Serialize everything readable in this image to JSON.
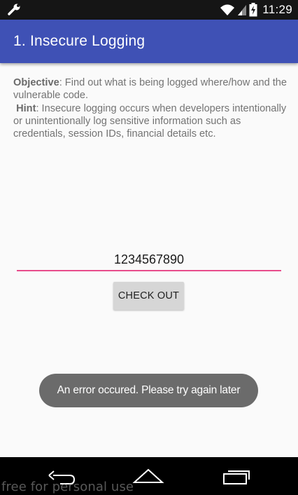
{
  "status_bar": {
    "time": "11:29",
    "icons": [
      "wrench-icon",
      "wifi-icon",
      "signal-icon",
      "battery-charging-icon"
    ]
  },
  "app_bar": {
    "title": "1. Insecure Logging",
    "color": "#3f51b5"
  },
  "content": {
    "objective_label": "Objective",
    "objective_text": ": Find out what is being logged where/how and the vulnerable code.",
    "hint_label": "Hint",
    "hint_text": ": Insecure logging occurs when developers intentionally or unintentionally log sensitive information such as credentials, session IDs, financial details etc."
  },
  "form": {
    "input_value": "1234567890",
    "checkout_label": "CHECK OUT",
    "accent_color": "#e84c8b"
  },
  "toast": {
    "message": "An error occured. Please try again later"
  },
  "nav_bar": {
    "icons": [
      "back-icon",
      "home-icon",
      "recents-icon"
    ]
  },
  "watermark": "free for personal use"
}
